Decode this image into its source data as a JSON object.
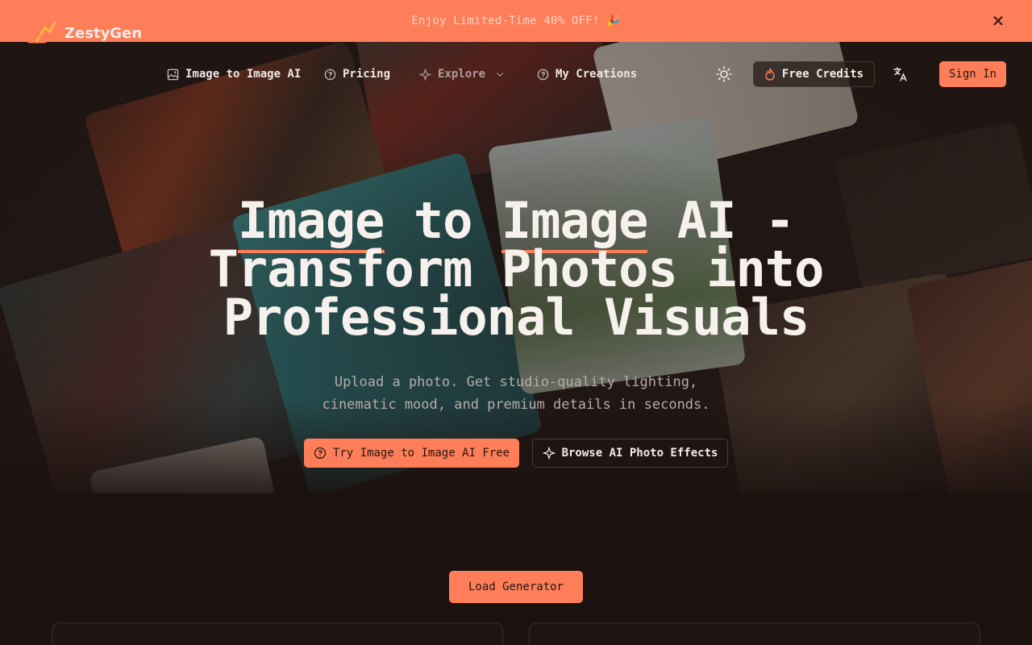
{
  "promo": {
    "text": "Enjoy Limited-Time 40% OFF! 🎉",
    "close_icon": "close-icon"
  },
  "nav": {
    "brand": "ZestyGen",
    "items": [
      {
        "label": "Image to Image AI",
        "icon": "image-icon"
      },
      {
        "label": "Pricing",
        "icon": "help-circle-icon"
      },
      {
        "label": "Explore",
        "icon": "sparkle-icon"
      },
      {
        "label": "My Creations",
        "icon": "help-circle-icon"
      }
    ],
    "free_credits": "Free Credits",
    "sign_in": "Sign In"
  },
  "hero": {
    "title_line1_a": "Image",
    "title_line1_b": " to ",
    "title_line1_c": "Image",
    "title_line1_d": " AI -",
    "title_line2": "Transform Photos into",
    "title_line3": "Professional Visuals",
    "subtitle_line1": "Upload a photo. Get studio-quality lighting,",
    "subtitle_line2": "cinematic mood, and premium details in seconds.",
    "cta_primary": "Try Image to Image AI Free",
    "cta_secondary": "Browse AI Photo Effects"
  },
  "generator": {
    "load_button": "Load Generator"
  },
  "colors": {
    "accent": "#fd7e59",
    "background": "#1b1210"
  }
}
